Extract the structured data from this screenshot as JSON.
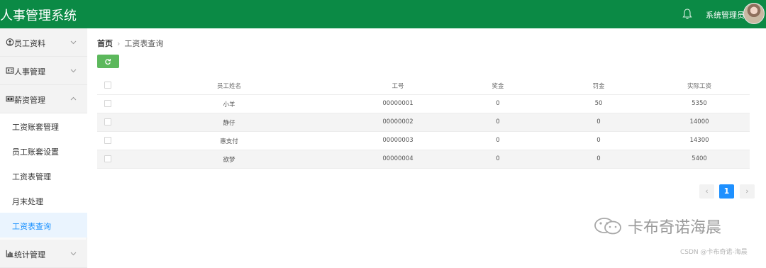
{
  "header": {
    "app_title": "人事管理系统",
    "user_name": "系统管理员",
    "brand_color": "#0b8a45"
  },
  "sidebar": {
    "groups": [
      {
        "label": "员工资料",
        "icon": "user-circle-icon"
      },
      {
        "label": "人事管理",
        "icon": "id-card-icon"
      },
      {
        "label": "薪资管理",
        "icon": "money-icon",
        "expanded": true
      },
      {
        "label": "统计管理",
        "icon": "bar-chart-icon"
      }
    ],
    "salary_items": [
      "工资账套管理",
      "员工账套设置",
      "工资表管理",
      "月末处理",
      "工资表查询"
    ],
    "active_item": "工资表查询"
  },
  "breadcrumb": {
    "home": "首页",
    "current": "工资表查询"
  },
  "toolbar": {
    "refresh_icon": "refresh-icon"
  },
  "table": {
    "headers": [
      "员工姓名",
      "工号",
      "奖金",
      "罚金",
      "实际工资"
    ],
    "rows": [
      {
        "name": "小羊",
        "id": "00000001",
        "bonus": "0",
        "fine": "50",
        "salary": "5350"
      },
      {
        "name": "静仔",
        "id": "00000002",
        "bonus": "0",
        "fine": "0",
        "salary": "14000"
      },
      {
        "name": "惠支付",
        "id": "00000003",
        "bonus": "0",
        "fine": "0",
        "salary": "14300"
      },
      {
        "name": "欲梦",
        "id": "00000004",
        "bonus": "0",
        "fine": "0",
        "salary": "5400"
      }
    ]
  },
  "pagination": {
    "prev": "‹",
    "current_page": "1",
    "next": "›"
  },
  "watermark": {
    "text": "卡布奇诺海晨",
    "source": "CSDN @卡布奇诺-海晨"
  }
}
